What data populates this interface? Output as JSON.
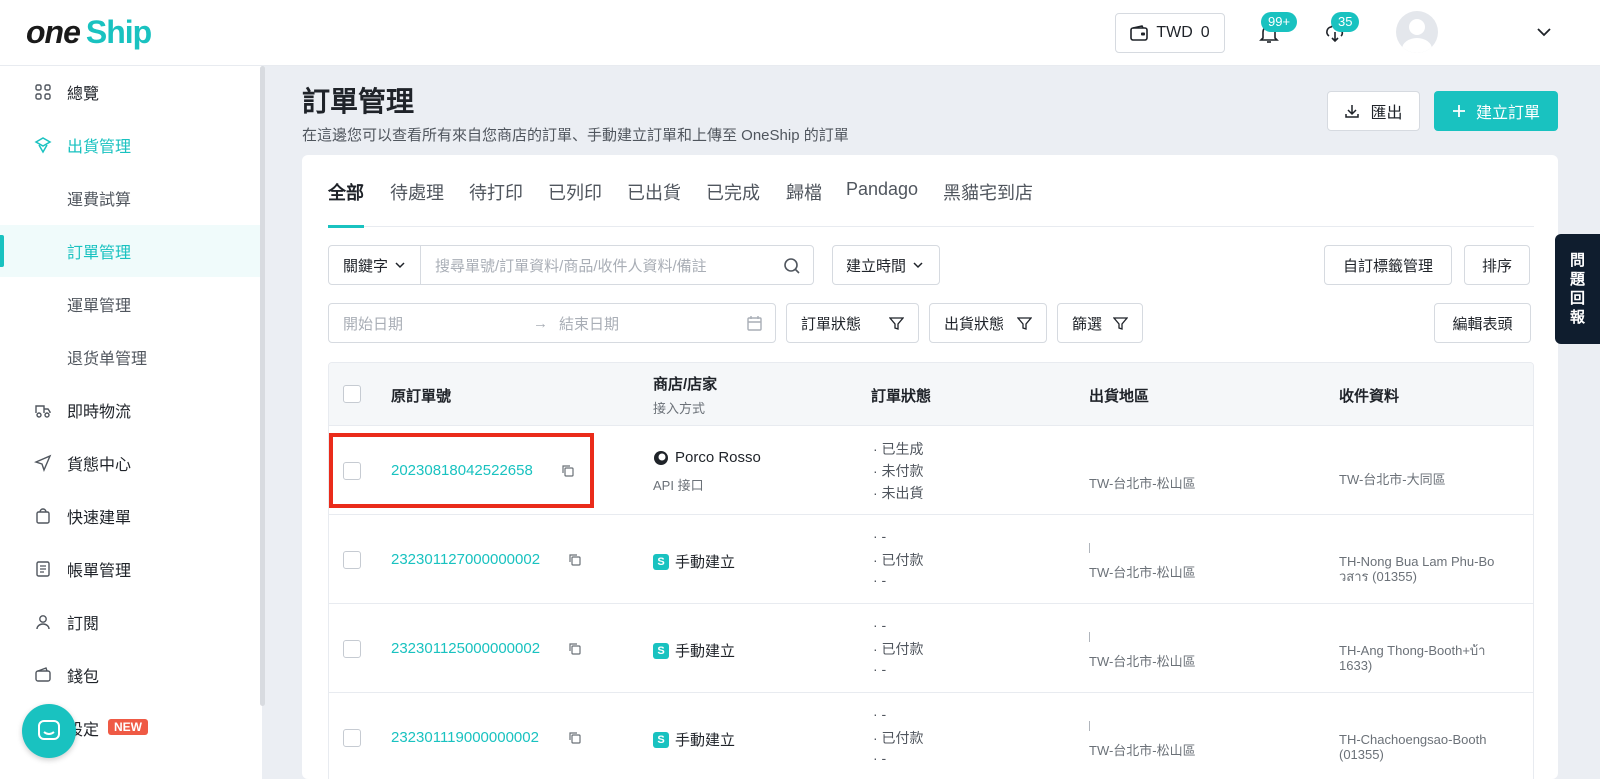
{
  "app": {
    "logo_one": "one",
    "logo_ship": "Ship"
  },
  "topbar": {
    "currency": "TWD",
    "balance": "0",
    "notifications_badge": "99+",
    "sync_badge": "35"
  },
  "sidebar": {
    "items": [
      {
        "label": "總覽",
        "icon": "grid-icon"
      },
      {
        "label": "出貨管理",
        "icon": "shipping-icon"
      },
      {
        "label": "運費試算"
      },
      {
        "label": "訂單管理"
      },
      {
        "label": "運單管理"
      },
      {
        "label": "退货单管理"
      },
      {
        "label": "即時物流",
        "icon": "delivery-icon"
      },
      {
        "label": "貨態中心",
        "icon": "send-icon"
      },
      {
        "label": "快速建單",
        "icon": "bag-icon"
      },
      {
        "label": "帳單管理",
        "icon": "bill-icon"
      },
      {
        "label": "訂閱",
        "icon": "user-icon"
      },
      {
        "label": "錢包",
        "icon": "wallet-icon"
      },
      {
        "label": "設定",
        "icon": "gear-icon",
        "badge": "NEW"
      }
    ]
  },
  "page": {
    "title": "訂單管理",
    "subtitle": "在這邊您可以查看所有來自您商店的訂單、手動建立訂單和上傳至 OneShip 的訂單",
    "export_label": "匯出",
    "create_label": "建立訂單"
  },
  "tabs": [
    "全部",
    "待處理",
    "待打印",
    "已列印",
    "已出貨",
    "已完成",
    "歸檔",
    "Pandago",
    "黑貓宅到店"
  ],
  "filters": {
    "keyword_select": "關鍵字",
    "search_placeholder": "搜尋單號/訂單資料/商品/收件人資料/備註",
    "time_select": "建立時間",
    "custom_tags": "自訂標籤管理",
    "sort": "排序",
    "start_date_placeholder": "開始日期",
    "end_date_placeholder": "結束日期",
    "order_status": "訂單狀態",
    "ship_status": "出貨狀態",
    "filter": "篩選",
    "edit_columns": "編輯表頭"
  },
  "table": {
    "headers": {
      "order_no": "原訂單號",
      "store": "商店/店家",
      "store_sub": "接入方式",
      "status": "訂單狀態",
      "region": "出貨地區",
      "receiver": "收件資料"
    },
    "rows": [
      {
        "order_no": "20230818042522658",
        "store": "Porco Rosso",
        "store_sub": "API 接口",
        "status": [
          "· 已生成",
          "· 未付款",
          "· 未出貨"
        ],
        "region": "TW-台北市-松山區",
        "receiver": [
          "TW-台北市-大同區",
          ""
        ]
      },
      {
        "order_no": "232301127000000002",
        "store": "手動建立",
        "status": [
          "· -",
          "· 已付款",
          "· -"
        ],
        "region": "TW-台北市-松山區",
        "receiver": [
          "TH-Nong Bua Lam Phu-Bo",
          "วสาร (01355)"
        ]
      },
      {
        "order_no": "232301125000000002",
        "store": "手動建立",
        "status": [
          "· -",
          "· 已付款",
          "· -"
        ],
        "region": "TW-台北市-松山區",
        "receiver": [
          "TH-Ang Thong-Booth+บ้า",
          "1633)"
        ]
      },
      {
        "order_no": "232301119000000002",
        "store": "手動建立",
        "status": [
          "· -",
          "· 已付款",
          "· -"
        ],
        "region": "TW-台北市-松山區",
        "receiver": [
          "TH-Chachoengsao-Booth",
          "(01355)"
        ]
      }
    ]
  },
  "feedback": [
    "問",
    "題",
    "回",
    "報"
  ],
  "colors": {
    "accent": "#19c2c0",
    "highlight": "#ea2b1a",
    "new_badge": "#ef5a45"
  }
}
